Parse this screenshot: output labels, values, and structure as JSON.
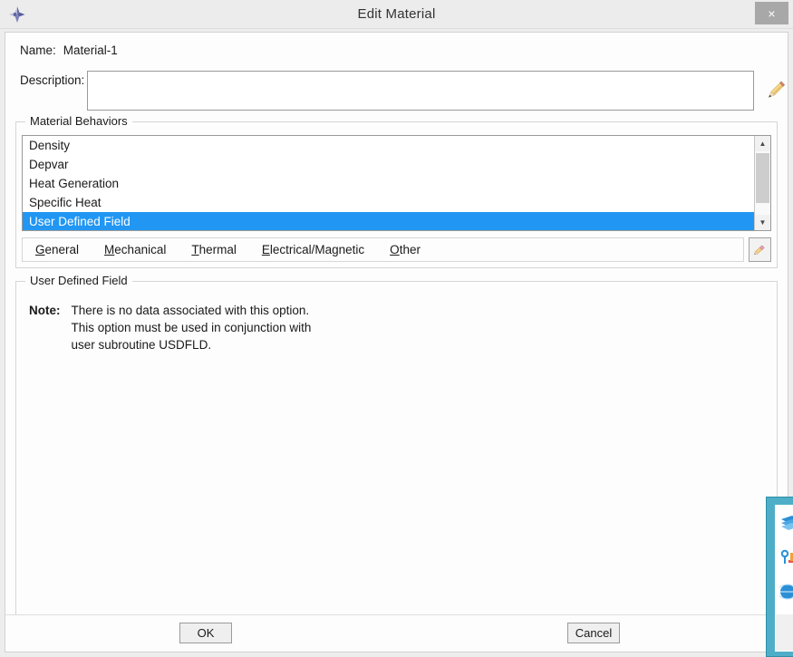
{
  "window": {
    "title": "Edit Material",
    "app_icon": "abaqus-diamond-icon",
    "close_label": "×"
  },
  "form": {
    "name_label": "Name:",
    "name_value": "Material-1",
    "description_label": "Description:",
    "description_value": "",
    "description_placeholder": "",
    "description_edit_icon": "pencil-icon"
  },
  "material_behaviors": {
    "legend": "Material Behaviors",
    "items": [
      {
        "label": "Density",
        "selected": false
      },
      {
        "label": "Depvar",
        "selected": false
      },
      {
        "label": "Heat Generation",
        "selected": false
      },
      {
        "label": "Specific Heat",
        "selected": false
      },
      {
        "label": "User Defined Field",
        "selected": true
      }
    ],
    "scrollbar": {
      "up_arrow": "▲",
      "down_arrow": "▼"
    },
    "selection_color": "#2196f3"
  },
  "menubar": {
    "items": [
      {
        "mnemonic": "G",
        "rest": "eneral"
      },
      {
        "mnemonic": "M",
        "rest": "echanical"
      },
      {
        "mnemonic": "T",
        "rest": "hermal"
      },
      {
        "mnemonic": "E",
        "rest": "lectrical/Magnetic"
      },
      {
        "mnemonic": "O",
        "rest": "ther"
      }
    ],
    "edit_icon": "pencil-eraser-icon"
  },
  "detail": {
    "legend": "User Defined Field",
    "note_label": "Note:",
    "note_lines": [
      "There is no data associated with this option.",
      "This option must be used in conjunction with",
      "user subroutine USDFLD."
    ]
  },
  "footer": {
    "ok_label": "OK",
    "cancel_label": "Cancel"
  },
  "background_panel": {
    "accent_color": "#4eaec8",
    "icons": [
      "layers-icon",
      "tools-icon",
      "globe-icon"
    ]
  }
}
